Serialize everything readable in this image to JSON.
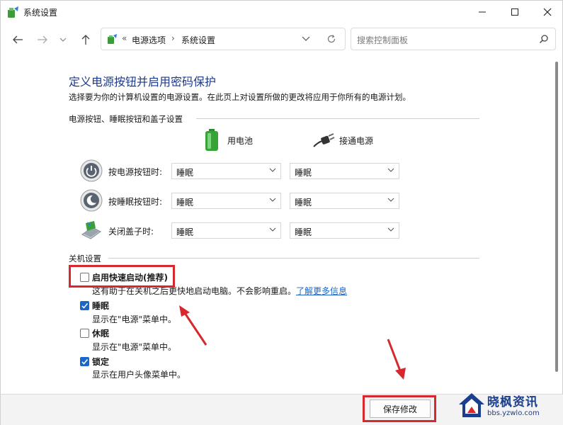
{
  "window": {
    "title": "系统设置",
    "controls": [
      "minimize",
      "maximize",
      "close"
    ]
  },
  "nav": {
    "breadcrumb": [
      "电源选项",
      "系统设置"
    ],
    "breadcrumb_prefix": "«",
    "separator": "›",
    "search_placeholder": "搜索控制面板"
  },
  "page": {
    "title": "定义电源按钮并启用密码保护",
    "description": "选择要为你的计算机设置的电源设置。在此页上对设置所做的更改将应用于你所有的电源计划。"
  },
  "buttons_section": {
    "heading": "电源按钮、睡眠按钮和盖子设置",
    "columns": [
      {
        "label": "用电池",
        "icon": "battery-icon"
      },
      {
        "label": "接通电源",
        "icon": "plug-icon"
      }
    ],
    "rows": [
      {
        "label": "按电源按钮时:",
        "icon": "power-button-icon",
        "battery": "睡眠",
        "plugged": "睡眠"
      },
      {
        "label": "按睡眠按钮时:",
        "icon": "sleep-button-icon",
        "battery": "睡眠",
        "plugged": "睡眠"
      },
      {
        "label": "关闭盖子时:",
        "icon": "laptop-lid-icon",
        "battery": "睡眠",
        "plugged": "睡眠"
      }
    ]
  },
  "shutdown_section": {
    "heading": "关机设置",
    "options": [
      {
        "label": "启用快速启动(推荐)",
        "checked": false,
        "desc": "这有助于在关机之后更快地启动电脑。不会影响重启。",
        "link": "了解更多信息"
      },
      {
        "label": "睡眠",
        "checked": true,
        "desc": "显示在\"电源\"菜单中。"
      },
      {
        "label": "休眠",
        "checked": false,
        "desc": "显示在\"电源\"菜单中。"
      },
      {
        "label": "锁定",
        "checked": true,
        "desc": "显示在用户头像菜单中。"
      }
    ]
  },
  "footer": {
    "save_label": "保存修改"
  },
  "watermark": {
    "title": "晓枫资讯",
    "url": "bbs.yzwlo.com"
  },
  "colors": {
    "accent": "#1a66c9",
    "title": "#1e3a8a",
    "highlight": "#d7282e"
  }
}
